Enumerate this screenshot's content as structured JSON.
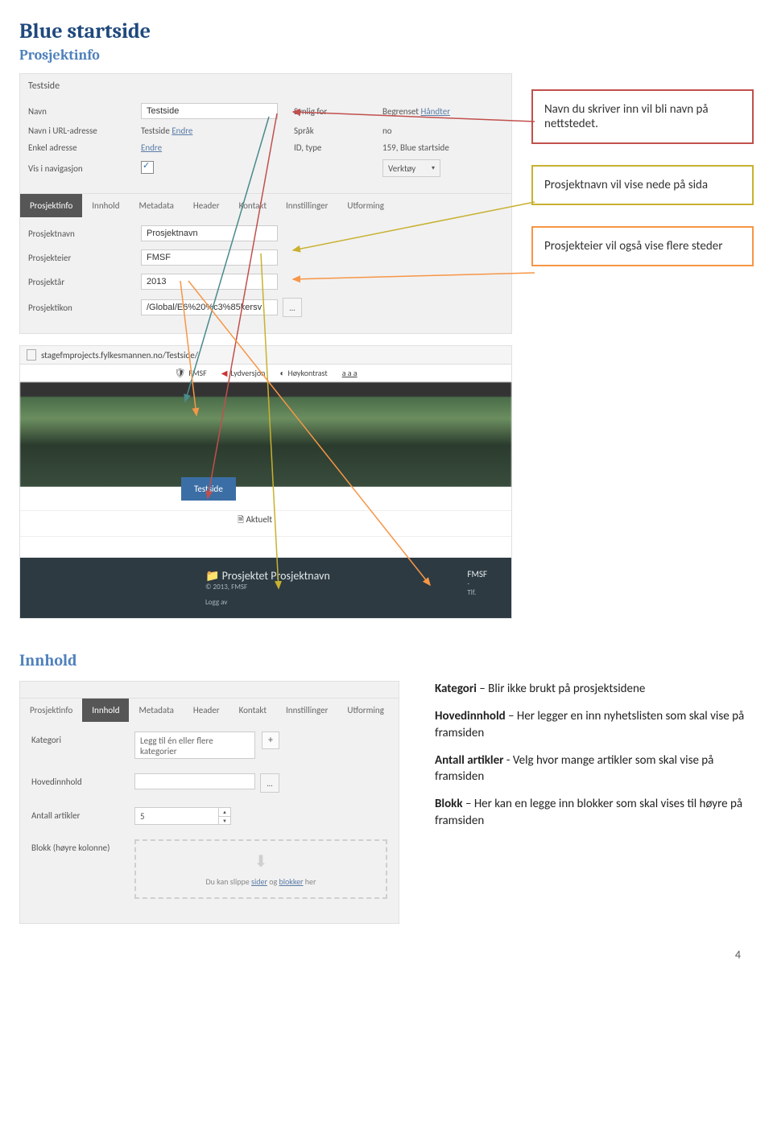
{
  "page": {
    "title": "Blue startside",
    "subtitle1": "Prosjektinfo",
    "section2": "Innhold",
    "pagenum": "4"
  },
  "cms": {
    "breadcrumb": "Testside",
    "labels": {
      "navn": "Navn",
      "navn_url": "Navn i URL-adresse",
      "enkel": "Enkel adresse",
      "vis_nav": "Vis i navigasjon",
      "synlig": "Synlig for",
      "sprak": "Språk",
      "idtype": "ID, type"
    },
    "values": {
      "navn": "Testside",
      "navn_url": "Testside",
      "endre1": "Endre",
      "endre2": "Endre",
      "synlig_val": "Begrenset",
      "handter": "Håndter",
      "sprak_val": "no",
      "idtype_val": "159, Blue startside",
      "verktoy": "Verktøy"
    },
    "tabs": [
      "Prosjektinfo",
      "Innhold",
      "Metadata",
      "Header",
      "Kontakt",
      "Innstillinger",
      "Utforming"
    ],
    "prosjekt": {
      "label_navn": "Prosjektnavn",
      "label_eier": "Prosjekteier",
      "label_aar": "Prosjektår",
      "label_ikon": "Prosjektikon",
      "val_navn": "Prosjektnavn",
      "val_eier": "FMSF",
      "val_aar": "2013",
      "val_ikon": "/Global/E6%20%c3%85kersv"
    }
  },
  "callouts": {
    "c1": "Navn du skriver inn vil bli navn på nettstedet.",
    "c2": "Prosjektnavn vil vise nede på sida",
    "c3": "Prosjekteier vil også vise flere steder"
  },
  "preview": {
    "url": "stagefmprojects.fylkesmannen.no/Testside/",
    "toolbar": {
      "fmsf": "FMSF",
      "lyd": "Lydversjon",
      "hoy": "Høykontrast",
      "aaa": "a a a"
    },
    "pill": "Testside",
    "aktuelt": "Aktuelt",
    "footer": {
      "proj": "Prosjektet Prosjektnavn",
      "copy": "© 2013, FMSF",
      "loggav": "Logg av",
      "fmsf": "FMSF",
      "dash": "-",
      "tlf": "Tlf."
    }
  },
  "cms2": {
    "tabs": [
      "Prosjektinfo",
      "Innhold",
      "Metadata",
      "Header",
      "Kontakt",
      "Innstillinger",
      "Utforming"
    ],
    "labels": {
      "kategori": "Kategori",
      "hoved": "Hovedinnhold",
      "antall": "Antall artikler",
      "blokk": "Blokk (høyre kolonne)"
    },
    "values": {
      "kategori_ph": "Legg til én eller flere kategorier",
      "antall": "5"
    },
    "dropzone": {
      "text_pre": "Du kan slippe ",
      "sider": "sider",
      "og": " og ",
      "blokker": "blokker",
      "text_post": " her"
    }
  },
  "desc": {
    "k_bold": "Kategori",
    "k_rest": " – Blir ikke brukt på prosjektsidene",
    "h_bold": "Hovedinnhold",
    "h_rest": " – Her legger en inn nyhetslisten som skal vise på framsiden",
    "a_bold": "Antall artikler",
    "a_rest": " - Velg hvor mange artikler som skal vise på framsiden",
    "b_bold": "Blokk",
    "b_rest": " – Her kan en legge inn blokker som skal vises til høyre på framsiden"
  }
}
